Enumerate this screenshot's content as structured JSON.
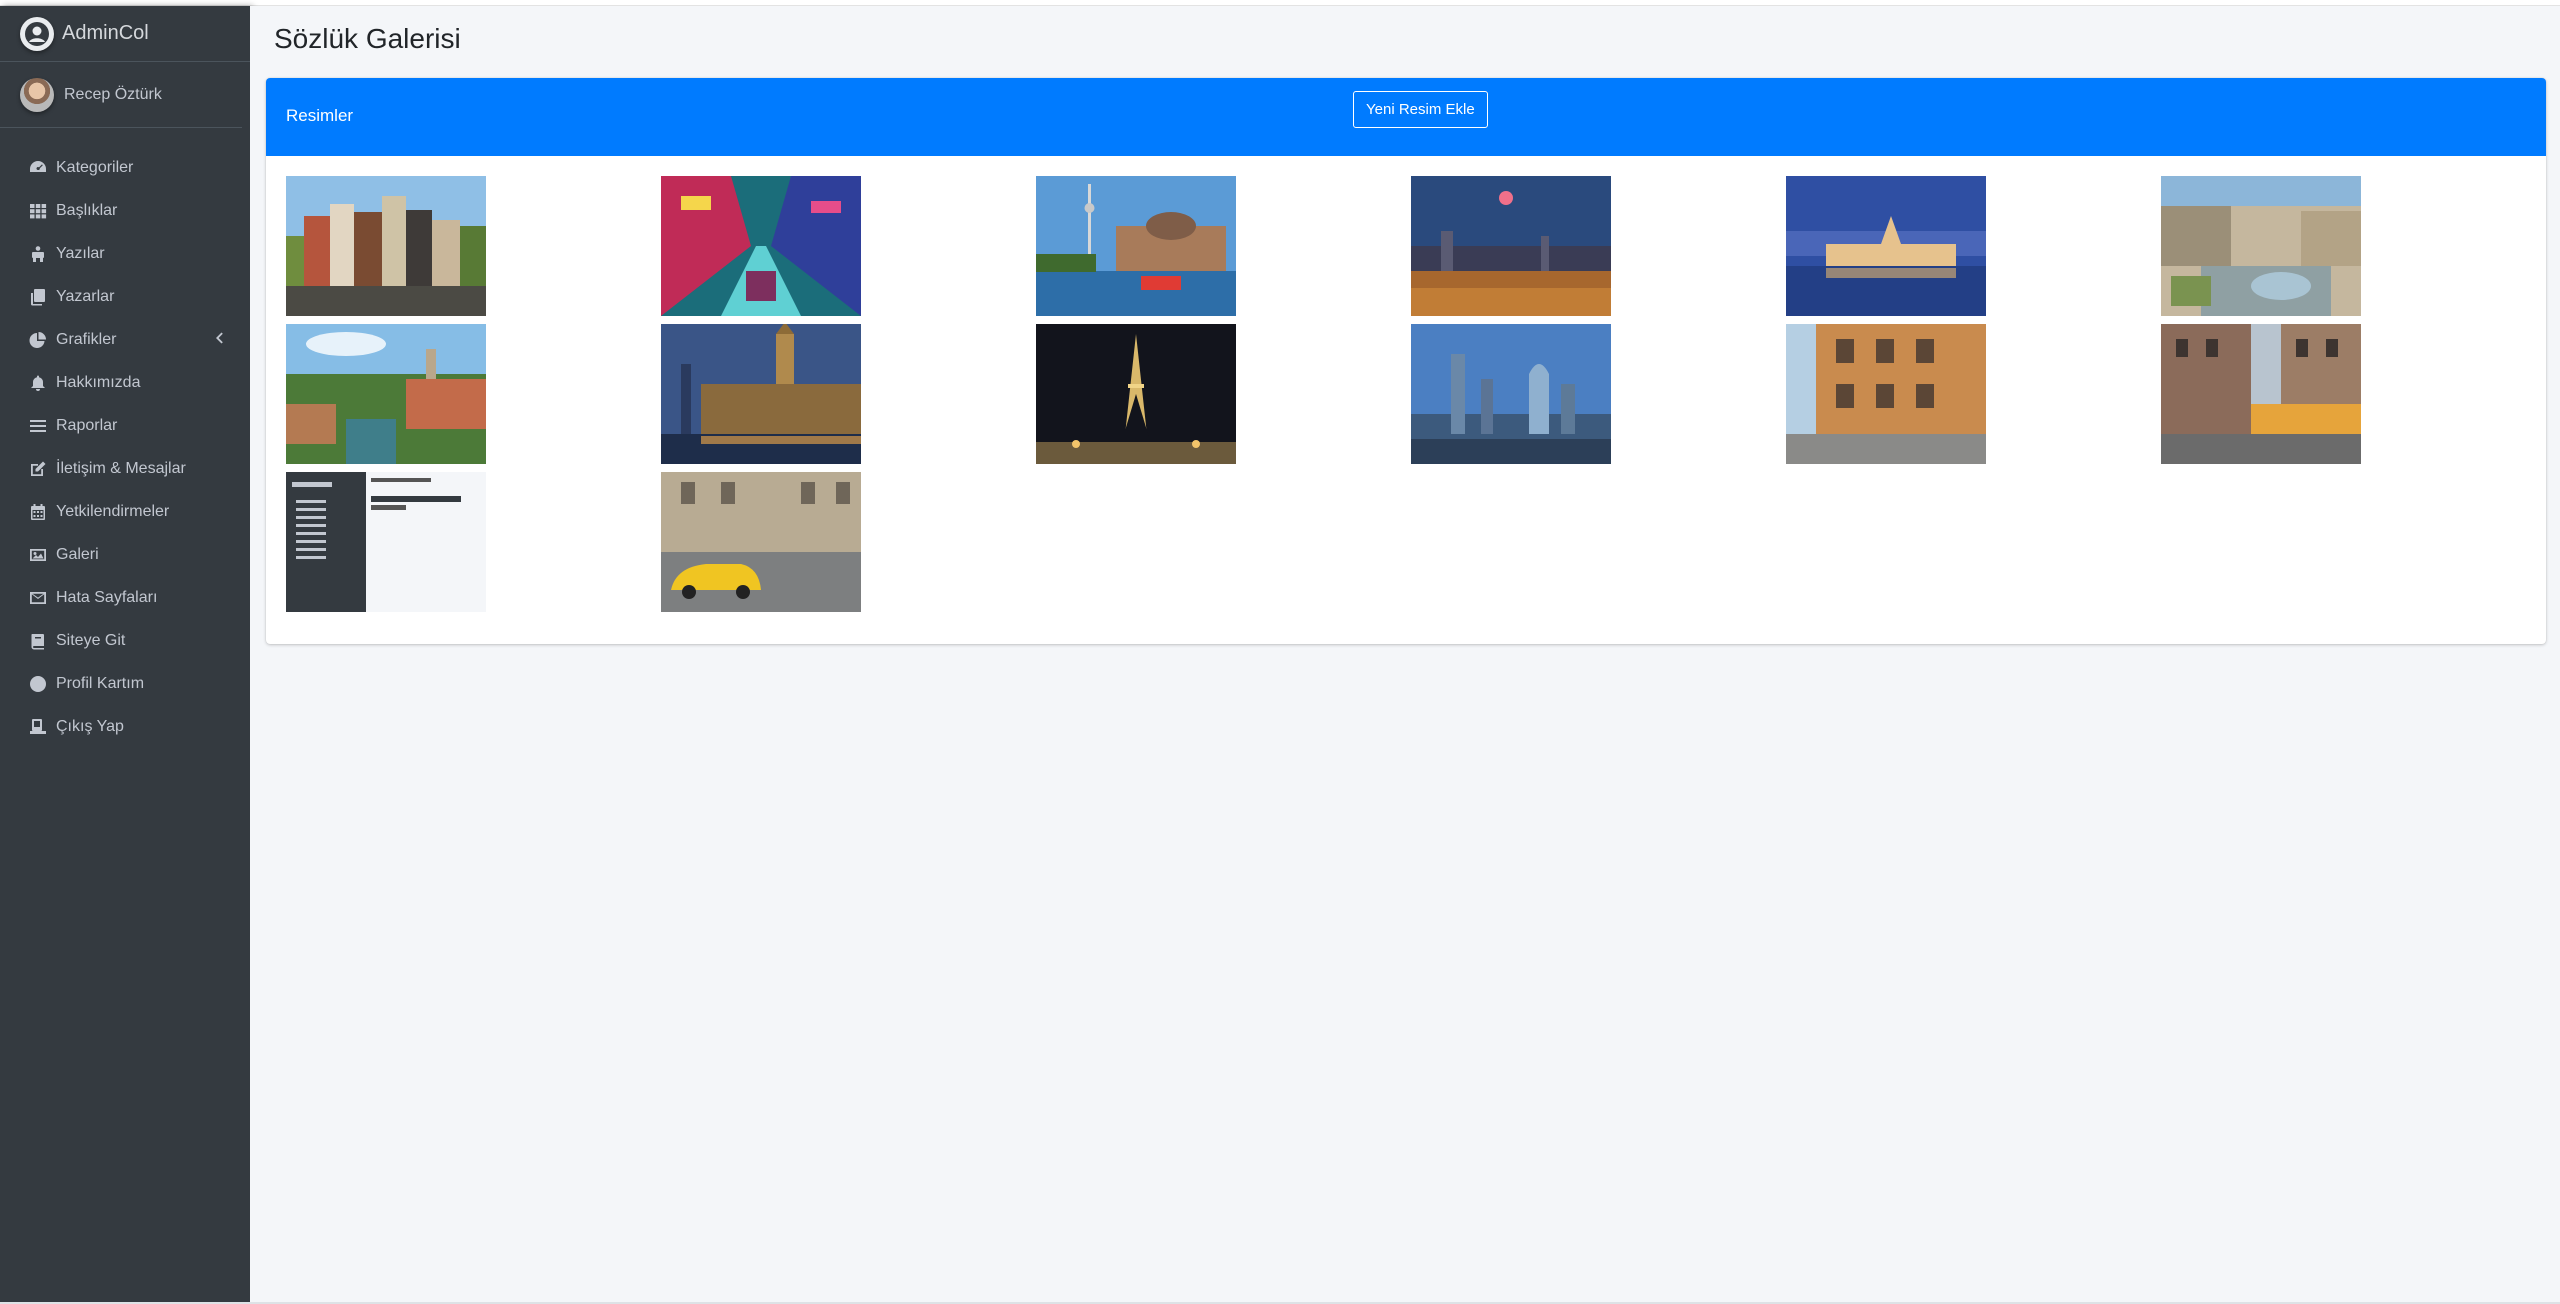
{
  "brand": {
    "name": "AdminCol"
  },
  "user": {
    "name": "Recep Öztürk"
  },
  "sidebar": {
    "items": [
      {
        "label": "Kategoriler",
        "icon": "dashboard-gauge-icon"
      },
      {
        "label": "Başlıklar",
        "icon": "grid-icon"
      },
      {
        "label": "Yazılar",
        "icon": "people-carry-icon"
      },
      {
        "label": "Yazarlar",
        "icon": "copy-icon"
      },
      {
        "label": "Grafikler",
        "icon": "pie-chart-icon",
        "expandable": true
      },
      {
        "label": "Hakkımızda",
        "icon": "bell-icon"
      },
      {
        "label": "Raporlar",
        "icon": "list-icon"
      },
      {
        "label": "İletişim & Mesajlar",
        "icon": "edit-icon"
      },
      {
        "label": "Yetkilendirmeler",
        "icon": "calendar-icon"
      },
      {
        "label": "Galeri",
        "icon": "image-icon"
      },
      {
        "label": "Hata Sayfaları",
        "icon": "envelope-icon"
      },
      {
        "label": "Siteye Git",
        "icon": "book-icon"
      },
      {
        "label": "Profil Kartım",
        "icon": "circle-icon"
      },
      {
        "label": "Çıkış Yap",
        "icon": "user-logout-icon"
      }
    ]
  },
  "page": {
    "title": "Sözlük Galerisi"
  },
  "card": {
    "title": "Resimler",
    "add_button": "Yeni Resim Ekle"
  },
  "gallery": {
    "images": [
      {
        "name": "amsterdam-canal-houses-image"
      },
      {
        "name": "neon-city-street-image"
      },
      {
        "name": "berlin-museum-island-image"
      },
      {
        "name": "night-city-skyline-image"
      },
      {
        "name": "budapest-parliament-image"
      },
      {
        "name": "city-aerial-square-image"
      },
      {
        "name": "ljubljana-river-town-image"
      },
      {
        "name": "london-big-ben-image"
      },
      {
        "name": "eiffel-tower-night-image"
      },
      {
        "name": "modern-skyscrapers-image"
      },
      {
        "name": "orange-building-street-image"
      },
      {
        "name": "tram-old-buildings-image"
      },
      {
        "name": "admin-panel-screenshot-image"
      },
      {
        "name": "yellow-taxi-street-image"
      }
    ]
  },
  "colors": {
    "sidebar_bg": "#343a40",
    "content_bg": "#f4f6f9",
    "card_header": "#007bff",
    "sidebar_text": "#c2c7d0"
  }
}
